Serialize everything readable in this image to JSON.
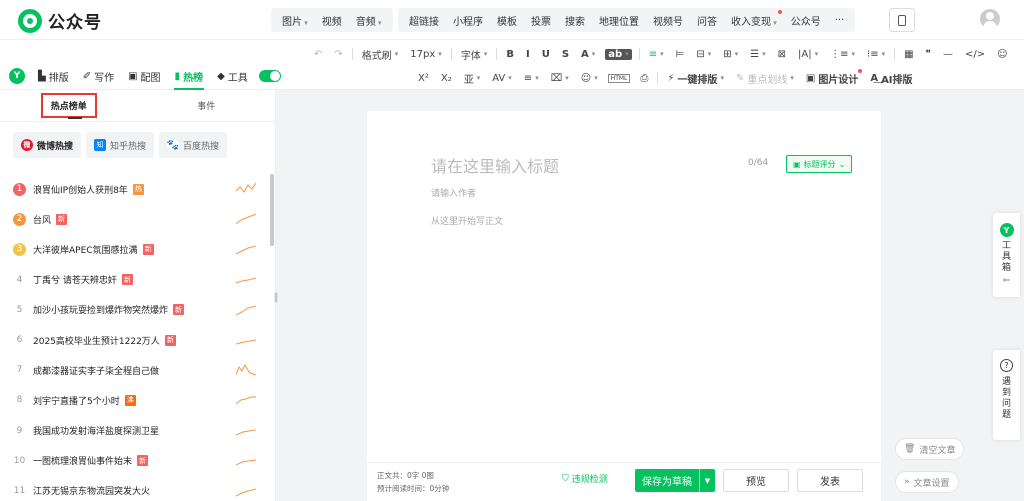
{
  "app": {
    "name": "公众号"
  },
  "top_insert": {
    "group1": [
      "图片",
      "视频",
      "音频"
    ],
    "group2": [
      "超链接",
      "小程序",
      "模板",
      "投票",
      "搜索",
      "地理位置",
      "视频号",
      "问答",
      "收入变现",
      "公众号",
      "···"
    ]
  },
  "toolbar": {
    "row1": [
      "↶",
      "↷",
      "格式刷",
      "17px",
      "字体",
      "B",
      "I",
      "U",
      "S",
      "A",
      "ab",
      "≡",
      "⊨",
      "⊟",
      "⊞",
      "☰",
      "⊠",
      "|A|",
      "⋮≡",
      "⁝≡",
      "▦",
      "❞",
      "—",
      "</>",
      "☺"
    ],
    "row2_format": [
      "X²",
      "X₂",
      "亚",
      "AV",
      "≡",
      "⌧",
      "☺",
      "HTML",
      "⎙"
    ],
    "one_click": "一键排版",
    "highlight": "重点划线",
    "image_design": "图片设计",
    "ai_layout": "AI排版"
  },
  "nav_tabs": [
    "排版",
    "写作",
    "配图",
    "热榜",
    "工具"
  ],
  "left_panel": {
    "sub_tabs": [
      "热点榜单",
      "事件"
    ],
    "sources": [
      "微博热搜",
      "知乎热搜",
      "百度热搜"
    ],
    "hot_items": [
      {
        "rank": "1",
        "text": "浪胃仙IP创始人获刑8年",
        "badge": "热",
        "badge_type": "hot",
        "trend": "0,10 4,6 8,11 12,4 16,8 20,2"
      },
      {
        "rank": "2",
        "text": "台风",
        "badge": "新",
        "badge_type": "new",
        "trend": "0,13 5,9 10,7 15,5 20,3"
      },
      {
        "rank": "3",
        "text": "大洋彼岸APEC氛围感拉满",
        "badge": "新",
        "badge_type": "new",
        "trend": "0,13 6,10 12,7 20,5"
      },
      {
        "rank": "4",
        "text": "丁禹兮 请苍天辨忠奸",
        "badge": "新",
        "badge_type": "new",
        "trend": "0,11 6,9 12,8 20,6"
      },
      {
        "rank": "5",
        "text": "加沙小孩玩耍捡到爆炸物突然爆炸",
        "badge": "新",
        "badge_type": "new",
        "trend": "0,13 6,10 12,6 20,4"
      },
      {
        "rank": "6",
        "text": "2025高校毕业生预计1222万人",
        "badge": "新",
        "badge_type": "new",
        "trend": "0,12 8,10 14,9 20,8"
      },
      {
        "rank": "7",
        "text": "成都漆器证实李子柒全程自己做",
        "badge": "",
        "badge_type": "",
        "trend": "0,13 3,5 6,9 9,3 13,10 17,12 20,13"
      },
      {
        "rank": "8",
        "text": "刘宇宁直播了5个小时",
        "badge": "沸",
        "badge_type": "boil",
        "trend": "0,12 5,8 10,7 15,5 20,5"
      },
      {
        "rank": "9",
        "text": "我国成功发射海洋盐度探测卫星",
        "badge": "",
        "badge_type": "",
        "trend": "0,12 7,9 13,8 20,7"
      },
      {
        "rank": "10",
        "text": "一图梳理浪胃仙事件始末",
        "badge": "新",
        "badge_type": "new",
        "trend": "0,12 6,9 12,8 20,7"
      },
      {
        "rank": "11",
        "text": "江苏无锡京东物流园突发大火",
        "badge": "",
        "badge_type": "",
        "trend": "0,13 6,10 12,8 20,6"
      }
    ]
  },
  "editor": {
    "title_placeholder": "请在这里输入标题",
    "count": "0/64",
    "title_score": "标题评分",
    "author_placeholder": "请输入作者",
    "body_placeholder": "从这里开始写正文"
  },
  "footer": {
    "stats_line1": "正文共：0字 0图",
    "stats_line2": "预计阅读时间：0分钟",
    "violation": "违规检测",
    "save": "保存为草稿",
    "preview": "预览",
    "publish": "发表"
  },
  "side": {
    "toolbox": "工具箱",
    "help": "遇到问题",
    "clear": "清空文章",
    "settings": "文章设置"
  },
  "colors": {
    "brand": "#07c160",
    "red": "#e53935"
  }
}
